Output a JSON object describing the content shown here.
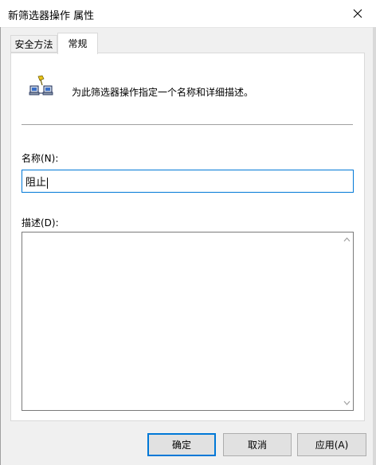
{
  "window": {
    "title": "新筛选器操作 属性"
  },
  "tabs": [
    {
      "label": "安全方法",
      "active": false
    },
    {
      "label": "常规",
      "active": true
    }
  ],
  "general": {
    "description_text": "为此筛选器操作指定一个名称和详细描述。",
    "icon": "network-filter-icon",
    "name_label": "名称(N):",
    "name_value": "阻止",
    "desc_label": "描述(D):",
    "desc_value": ""
  },
  "buttons": {
    "ok": "确定",
    "cancel": "取消",
    "apply": "应用(A)"
  },
  "colors": {
    "focus_accent": "#0078d7",
    "panel_bg": "#ffffff",
    "dialog_bg": "#f0f0f0"
  }
}
